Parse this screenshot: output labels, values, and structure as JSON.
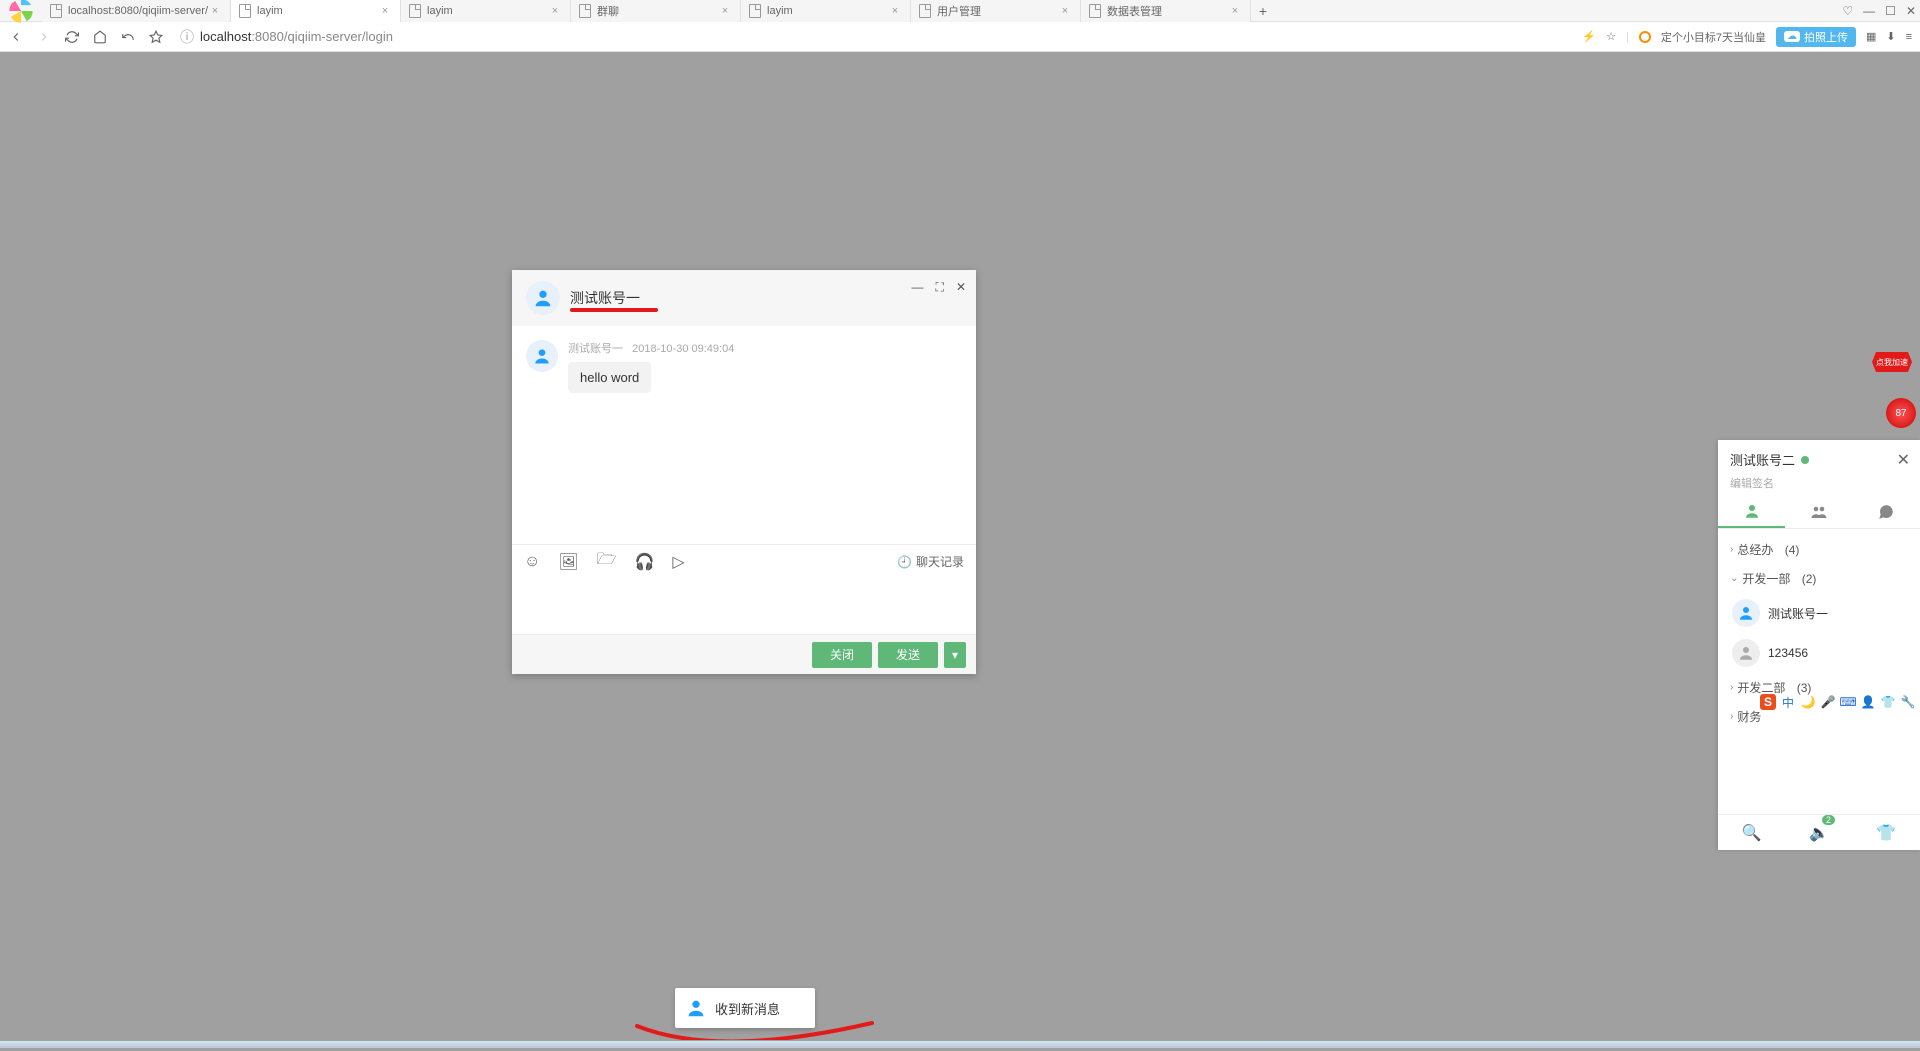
{
  "browser": {
    "tabs": [
      {
        "label": "localhost:8080/qiqiim-server/",
        "active": false
      },
      {
        "label": "layim",
        "active": true
      },
      {
        "label": "layim",
        "active": false
      },
      {
        "label": "群聊",
        "active": false
      },
      {
        "label": "layim",
        "active": false
      },
      {
        "label": "用户管理",
        "active": false
      },
      {
        "label": "数据表管理",
        "active": false
      }
    ],
    "url_host": "localhost",
    "url_port": ":8080",
    "url_path": "/qiqiim-server/login",
    "right_hint": "定个小目标7天当仙皇",
    "upload_label": "拍照上传"
  },
  "chat": {
    "title": "测试账号一",
    "msg_sender": "测试账号一",
    "msg_time": "2018-10-30 09:49:04",
    "msg_text": "hello word",
    "history_label": "聊天记录",
    "close_label": "关闭",
    "send_label": "发送"
  },
  "toast": {
    "text": "收到新消息"
  },
  "friends": {
    "me_name": "测试账号二",
    "signature": "编辑签名",
    "groups": {
      "g1": {
        "name": "总经办",
        "count": "(4)"
      },
      "g2": {
        "name": "开发一部",
        "count": "(2)"
      },
      "g3": {
        "name": "开发二部",
        "count": "(3)"
      },
      "g4": {
        "name": "财务",
        "count": ""
      }
    },
    "contacts": {
      "c1": "测试账号一",
      "c2": "123456"
    },
    "badge": "2"
  },
  "ime": {
    "lang": "中"
  },
  "promo": {
    "burst": "点我加速",
    "num": "87"
  }
}
